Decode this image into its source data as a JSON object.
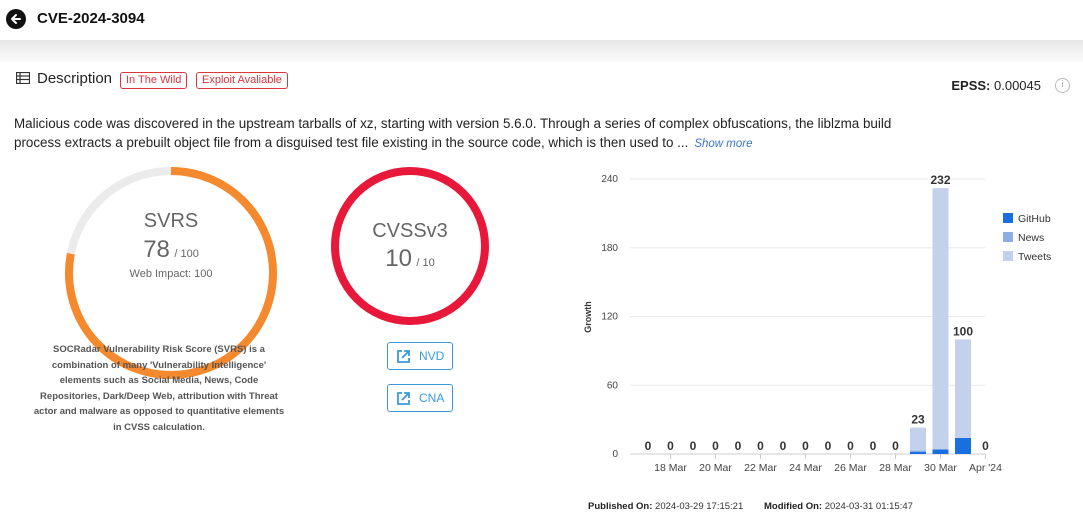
{
  "header": {
    "title": "CVE-2024-3094"
  },
  "description": {
    "label": "Description",
    "tags": [
      "In The Wild",
      "Exploit Avaliable"
    ],
    "epss_label": "EPSS:",
    "epss_value": "0.00045",
    "text": "Malicious code was discovered in the upstream tarballs of xz, starting with version 5.6.0. Through a series of complex obfuscations, the liblzma build process extracts a prebuilt object file from a disguised test file existing in the source code, which is then used to ...",
    "show_more": "Show more"
  },
  "svrs": {
    "label": "SVRS",
    "score": "78",
    "max": "/ 100",
    "score_fraction": 0.78,
    "web_impact": "Web Impact: 100",
    "note": "SOCRadar Vulnerability Risk Score (SVRS) is a combination of many 'Vulnerability Intelligence' elements such as Social Media, News, Code Repositories, Dark/Deep Web, attribution with Threat actor and malware as opposed to quantitative elements in CVSS calculation.",
    "color": "#f4892d"
  },
  "cvss": {
    "label": "CVSSv3",
    "score": "10",
    "max": "/ 10",
    "score_fraction": 1.0,
    "color": "#e8183a"
  },
  "links": {
    "nvd": "NVD",
    "cna": "CNA"
  },
  "meta": {
    "published_label": "Published On:",
    "published_value": "2024-03-29 17:15:21",
    "modified_label": "Modified On:",
    "modified_value": "2024-03-31 01:15:47"
  },
  "chart_data": {
    "type": "bar",
    "stacked": true,
    "ylabel": "Growth",
    "ylim": [
      0,
      240
    ],
    "yticks": [
      0,
      60,
      120,
      180,
      240
    ],
    "xtick_labels": [
      "18 Mar",
      "20 Mar",
      "22 Mar",
      "24 Mar",
      "26 Mar",
      "28 Mar",
      "30 Mar",
      "Apr '24"
    ],
    "categories": [
      "17 Mar",
      "18 Mar",
      "19 Mar",
      "20 Mar",
      "21 Mar",
      "22 Mar",
      "23 Mar",
      "24 Mar",
      "25 Mar",
      "26 Mar",
      "27 Mar",
      "28 Mar",
      "29 Mar",
      "30 Mar",
      "31 Mar",
      "1 Apr"
    ],
    "totals": [
      0,
      0,
      0,
      0,
      0,
      0,
      0,
      0,
      0,
      0,
      0,
      0,
      23,
      232,
      100,
      0
    ],
    "series": [
      {
        "name": "GitHub",
        "color": "#1a6fe0",
        "values": [
          0,
          0,
          0,
          0,
          0,
          0,
          0,
          0,
          0,
          0,
          0,
          0,
          2,
          4,
          14,
          0
        ]
      },
      {
        "name": "News",
        "color": "#8eaee3",
        "values": [
          0,
          0,
          0,
          0,
          0,
          0,
          0,
          0,
          0,
          0,
          0,
          0,
          1,
          0,
          0,
          0
        ]
      },
      {
        "name": "Tweets",
        "color": "#c3d1ec",
        "values": [
          0,
          0,
          0,
          0,
          0,
          0,
          0,
          0,
          0,
          0,
          0,
          0,
          20,
          228,
          86,
          0
        ]
      }
    ],
    "legend_position": "right",
    "grid": true
  }
}
